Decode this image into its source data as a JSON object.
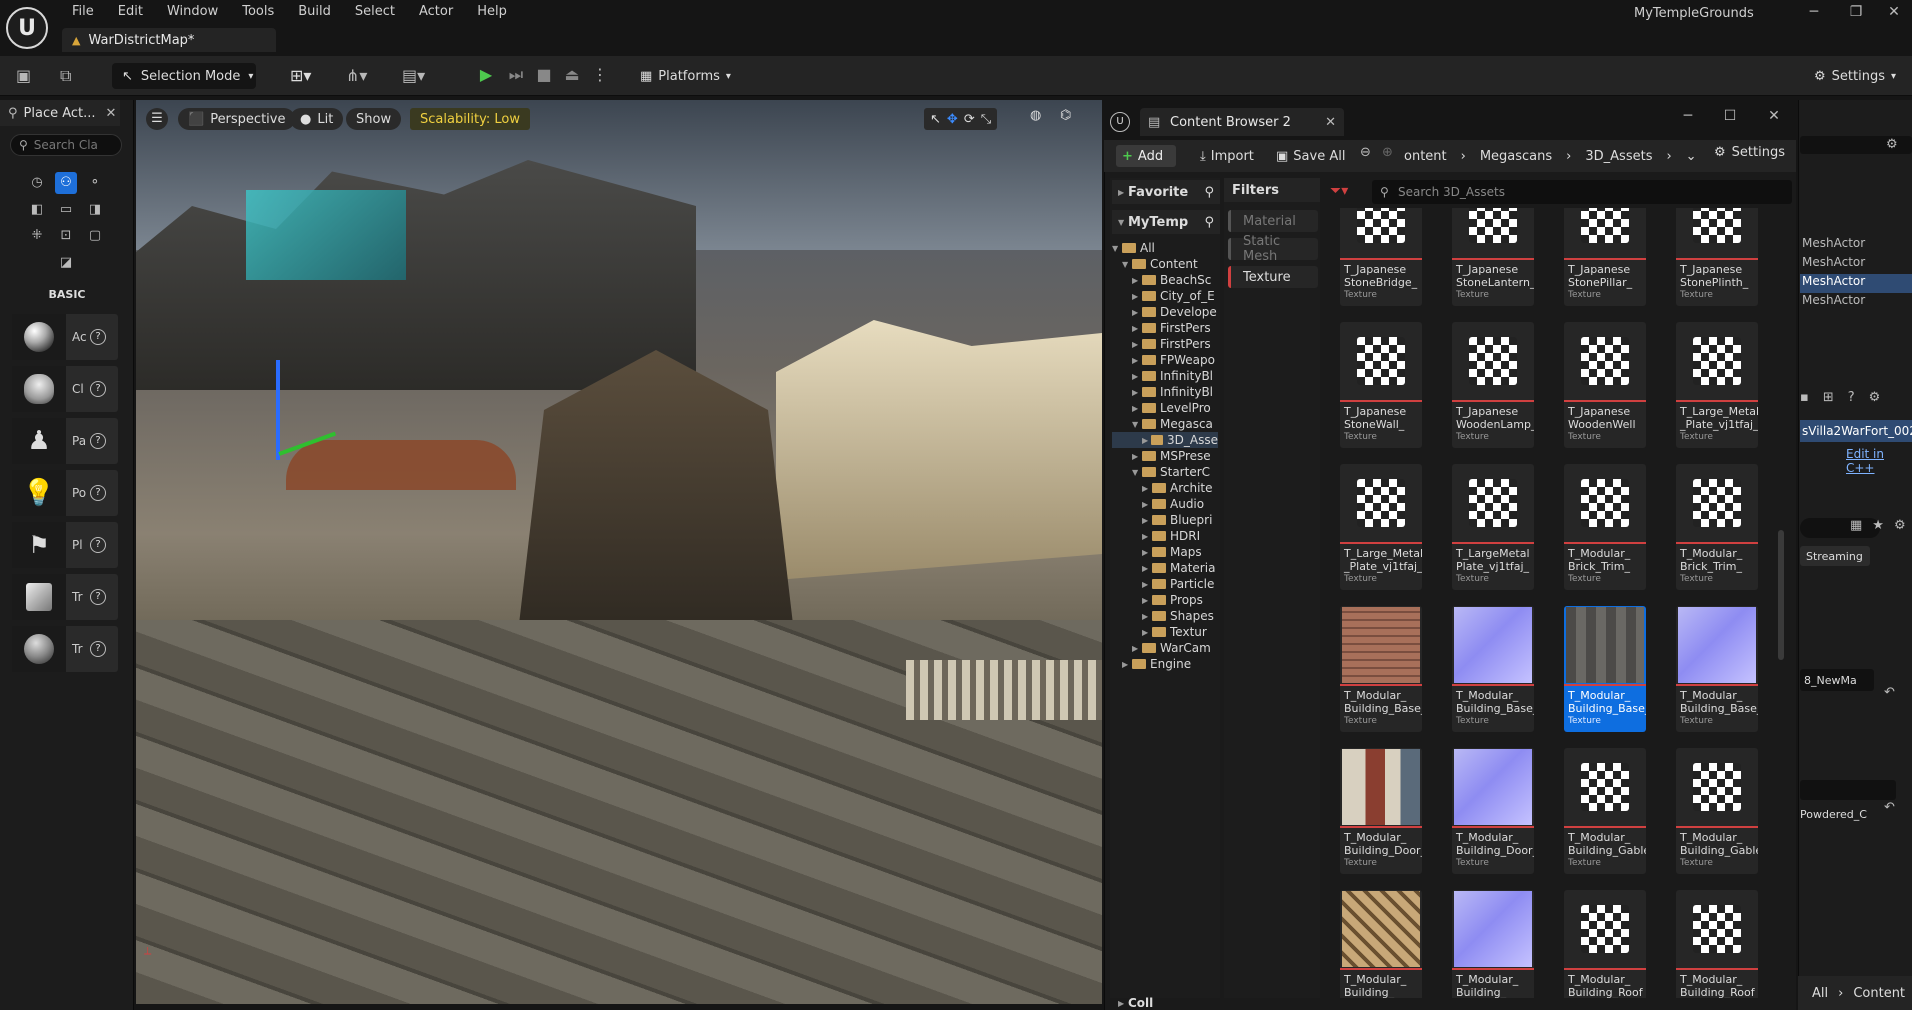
{
  "menubar": [
    "File",
    "Edit",
    "Window",
    "Tools",
    "Build",
    "Select",
    "Actor",
    "Help"
  ],
  "project_name": "MyTempleGrounds",
  "map_tab": "WarDistrictMap*",
  "toolbar": {
    "selection_mode": "Selection Mode",
    "platforms": "Platforms",
    "settings": "Settings"
  },
  "place_actors": {
    "title": "Place Act...",
    "search_placeholder": "Search Cla",
    "basic_label": "BASIC",
    "items": [
      {
        "label": "Ac",
        "icon": "sphere-icon"
      },
      {
        "label": "Cl",
        "icon": "head-icon"
      },
      {
        "label": "Pa",
        "icon": "pawn-icon"
      },
      {
        "label": "Po",
        "icon": "light-bulb-icon"
      },
      {
        "label": "Pl",
        "icon": "player-start-icon"
      },
      {
        "label": "Tr",
        "icon": "trigger-box-icon"
      },
      {
        "label": "Tr",
        "icon": "trigger-sphere-icon"
      }
    ]
  },
  "viewport": {
    "perspective": "Perspective",
    "lit": "Lit",
    "show": "Show",
    "scalability": "Scalability: Low"
  },
  "content_browser": {
    "tab_title": "Content Browser 2",
    "add": "Add",
    "import": "Import",
    "save_all": "Save All",
    "breadcrumb": [
      "ontent",
      "Megascans",
      "3D_Assets"
    ],
    "settings": "Settings",
    "search_placeholder": "Search 3D_Assets",
    "favorites": "Favorite",
    "project": "MyTemp",
    "filters_title": "Filters",
    "filters": [
      {
        "label": "Material",
        "active": false
      },
      {
        "label": "Static Mesh",
        "active": false
      },
      {
        "label": "Texture",
        "active": true
      }
    ],
    "tree": [
      {
        "label": "All",
        "depth": 0,
        "open": true
      },
      {
        "label": "Content",
        "depth": 1,
        "open": true
      },
      {
        "label": "BeachSc",
        "depth": 2
      },
      {
        "label": "City_of_E",
        "depth": 2
      },
      {
        "label": "Develope",
        "depth": 2
      },
      {
        "label": "FirstPers",
        "depth": 2
      },
      {
        "label": "FirstPers",
        "depth": 2
      },
      {
        "label": "FPWeapo",
        "depth": 2
      },
      {
        "label": "InfinityBl",
        "depth": 2
      },
      {
        "label": "InfinityBl",
        "depth": 2
      },
      {
        "label": "LevelPro",
        "depth": 2
      },
      {
        "label": "Megasca",
        "depth": 2,
        "open": true
      },
      {
        "label": "3D_Asse",
        "depth": 3,
        "selected": true
      },
      {
        "label": "MSPrese",
        "depth": 2
      },
      {
        "label": "StarterC",
        "depth": 2,
        "open": true
      },
      {
        "label": "Archite",
        "depth": 3
      },
      {
        "label": "Audio",
        "depth": 3
      },
      {
        "label": "Bluepri",
        "depth": 3
      },
      {
        "label": "HDRI",
        "depth": 3
      },
      {
        "label": "Maps",
        "depth": 3
      },
      {
        "label": "Materia",
        "depth": 3
      },
      {
        "label": "Particle",
        "depth": 3
      },
      {
        "label": "Props",
        "depth": 3
      },
      {
        "label": "Shapes",
        "depth": 3
      },
      {
        "label": "Textur",
        "depth": 3
      },
      {
        "label": "WarCam",
        "depth": 2
      },
      {
        "label": "Engine",
        "depth": 1
      }
    ],
    "collections": "Coll",
    "assets": [
      {
        "name": "T_Japanese StoneBridge_",
        "type": "Texture",
        "thumb": "checker"
      },
      {
        "name": "T_Japanese StoneLantern_",
        "type": "Texture",
        "thumb": "checker"
      },
      {
        "name": "T_Japanese StonePillar_",
        "type": "Texture",
        "thumb": "checker"
      },
      {
        "name": "T_Japanese StonePlinth_",
        "type": "Texture",
        "thumb": "checker"
      },
      {
        "name": "T_Japanese StoneWall_",
        "type": "Texture",
        "thumb": "checker"
      },
      {
        "name": "T_Japanese WoodenLamp_",
        "type": "Texture",
        "thumb": "checker"
      },
      {
        "name": "T_Japanese WoodenWell",
        "type": "Texture",
        "thumb": "checker"
      },
      {
        "name": "T_Large_Metal _Plate_vj1tfaj_",
        "type": "Texture",
        "thumb": "checker"
      },
      {
        "name": "T_Large_Metal _Plate_vj1tfaj_",
        "type": "Texture",
        "thumb": "checker"
      },
      {
        "name": "T_LargeMetal Plate_vj1tfaj_",
        "type": "Texture",
        "thumb": "checker"
      },
      {
        "name": "T_Modular_ Brick_Trim_",
        "type": "Texture",
        "thumb": "checker"
      },
      {
        "name": "T_Modular_ Brick_Trim_",
        "type": "Texture",
        "thumb": "checker"
      },
      {
        "name": "T_Modular_ Building_Base_",
        "type": "Texture",
        "thumb": "brick"
      },
      {
        "name": "T_Modular_ Building_Base_",
        "type": "Texture",
        "thumb": "normal"
      },
      {
        "name": "T_Modular_ Building_Base_",
        "type": "Texture",
        "thumb": "gray",
        "selected": true
      },
      {
        "name": "T_Modular_ Building_Base_",
        "type": "Texture",
        "thumb": "normal"
      },
      {
        "name": "T_Modular_ Building_Door_",
        "type": "Texture",
        "thumb": "door"
      },
      {
        "name": "T_Modular_ Building_Door_",
        "type": "Texture",
        "thumb": "normal"
      },
      {
        "name": "T_Modular_ Building_Gable",
        "type": "Texture",
        "thumb": "checker"
      },
      {
        "name": "T_Modular_ Building_Gable",
        "type": "Texture",
        "thumb": "checker"
      },
      {
        "name": "T_Modular_ Building_",
        "type": "Texture",
        "thumb": "tan"
      },
      {
        "name": "T_Modular_ Building_",
        "type": "Texture",
        "thumb": "normal"
      },
      {
        "name": "T_Modular_ Building_Roof",
        "type": "Texture",
        "thumb": "checker"
      },
      {
        "name": "T_Modular_ Building_Roof",
        "type": "Texture",
        "thumb": "checker"
      }
    ]
  },
  "details": {
    "outliner_rows": [
      "MeshActor",
      "MeshActor",
      "MeshActor",
      "MeshActor"
    ],
    "selected_row": 2,
    "actor_name": "sVilla2WarFort_002",
    "edit_cpp": "Edit in C++",
    "streaming": "Streaming",
    "material": "8_NewMa",
    "powdered": "Powdered_C",
    "bottom_all": "All",
    "bottom_content": "Content"
  }
}
